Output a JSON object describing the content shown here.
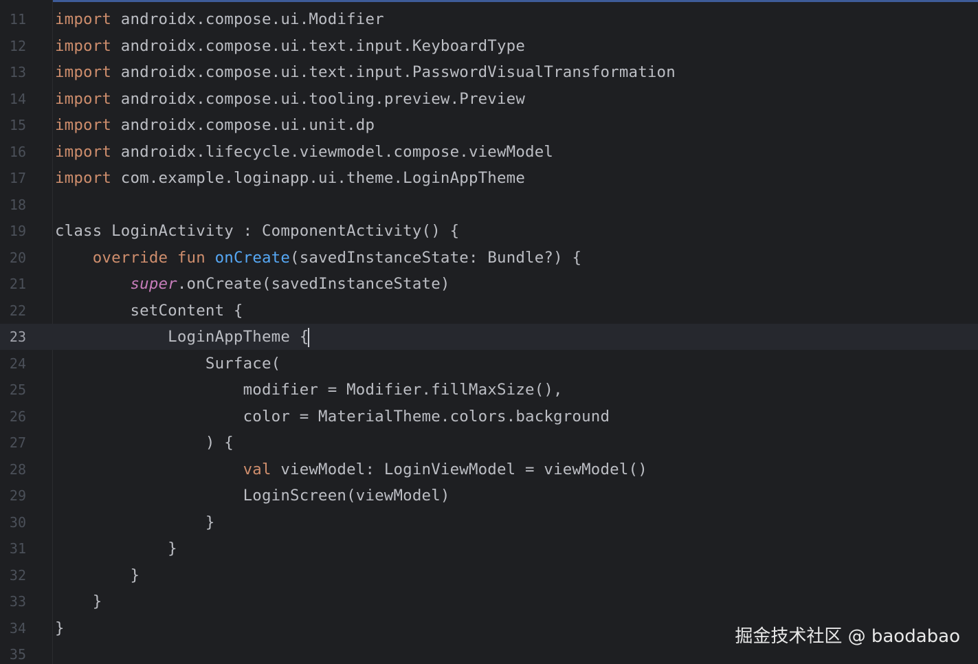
{
  "editor": {
    "lines": [
      {
        "num": "11",
        "tokens": [
          {
            "t": "import",
            "c": "kw"
          },
          {
            "t": " androidx.compose.ui.Modifier",
            "c": "plain"
          }
        ]
      },
      {
        "num": "12",
        "tokens": [
          {
            "t": "import",
            "c": "kw"
          },
          {
            "t": " androidx.compose.ui.text.input.KeyboardType",
            "c": "plain"
          }
        ]
      },
      {
        "num": "13",
        "tokens": [
          {
            "t": "import",
            "c": "kw"
          },
          {
            "t": " androidx.compose.ui.text.input.PasswordVisualTransformation",
            "c": "plain"
          }
        ]
      },
      {
        "num": "14",
        "tokens": [
          {
            "t": "import",
            "c": "kw"
          },
          {
            "t": " androidx.compose.ui.tooling.preview.Preview",
            "c": "plain"
          }
        ]
      },
      {
        "num": "15",
        "tokens": [
          {
            "t": "import",
            "c": "kw"
          },
          {
            "t": " androidx.compose.ui.unit.dp",
            "c": "plain"
          }
        ]
      },
      {
        "num": "16",
        "tokens": [
          {
            "t": "import",
            "c": "kw"
          },
          {
            "t": " androidx.lifecycle.viewmodel.compose.viewModel",
            "c": "plain"
          }
        ]
      },
      {
        "num": "17",
        "tokens": [
          {
            "t": "import",
            "c": "kw"
          },
          {
            "t": " com.example.loginapp.ui.theme.LoginAppTheme",
            "c": "plain"
          }
        ]
      },
      {
        "num": "18",
        "tokens": []
      },
      {
        "num": "19",
        "tokens": [
          {
            "t": "class LoginActivity : ComponentActivity() {",
            "c": "plain"
          }
        ]
      },
      {
        "num": "20",
        "tokens": [
          {
            "t": "    ",
            "c": "plain"
          },
          {
            "t": "override fun",
            "c": "kw"
          },
          {
            "t": " ",
            "c": "plain"
          },
          {
            "t": "onCreate",
            "c": "fn"
          },
          {
            "t": "(savedInstanceState: Bundle?) {",
            "c": "plain"
          }
        ]
      },
      {
        "num": "21",
        "tokens": [
          {
            "t": "        ",
            "c": "plain"
          },
          {
            "t": "super",
            "c": "sup"
          },
          {
            "t": ".onCreate(savedInstanceState)",
            "c": "plain"
          }
        ]
      },
      {
        "num": "22",
        "tokens": [
          {
            "t": "        setContent {",
            "c": "plain"
          }
        ]
      },
      {
        "num": "23",
        "current": true,
        "tokens": [
          {
            "t": "            LoginAppTheme {",
            "c": "plain"
          }
        ]
      },
      {
        "num": "24",
        "tokens": [
          {
            "t": "                Surface(",
            "c": "plain"
          }
        ]
      },
      {
        "num": "25",
        "tokens": [
          {
            "t": "                    modifier = Modifier.fillMaxSize(),",
            "c": "plain"
          }
        ]
      },
      {
        "num": "26",
        "tokens": [
          {
            "t": "                    color = MaterialTheme.colors.background",
            "c": "plain"
          }
        ]
      },
      {
        "num": "27",
        "tokens": [
          {
            "t": "                ) {",
            "c": "plain"
          }
        ]
      },
      {
        "num": "28",
        "tokens": [
          {
            "t": "                    ",
            "c": "plain"
          },
          {
            "t": "val",
            "c": "kw"
          },
          {
            "t": " viewModel: LoginViewModel = viewModel()",
            "c": "plain"
          }
        ]
      },
      {
        "num": "29",
        "tokens": [
          {
            "t": "                    LoginScreen(viewModel)",
            "c": "plain"
          }
        ]
      },
      {
        "num": "30",
        "tokens": [
          {
            "t": "                }",
            "c": "plain"
          }
        ]
      },
      {
        "num": "31",
        "tokens": [
          {
            "t": "            }",
            "c": "plain"
          }
        ]
      },
      {
        "num": "32",
        "tokens": [
          {
            "t": "        }",
            "c": "plain"
          }
        ]
      },
      {
        "num": "33",
        "tokens": [
          {
            "t": "    }",
            "c": "plain"
          }
        ]
      },
      {
        "num": "34",
        "tokens": [
          {
            "t": "}",
            "c": "plain"
          }
        ]
      },
      {
        "num": "35",
        "tokens": []
      }
    ]
  },
  "colors": {
    "background": "#1e1f22",
    "current_line": "#26282e",
    "keyword": "#cf8e6d",
    "function": "#56a8f5",
    "super": "#c77dbb",
    "text": "#bcbec4",
    "line_number": "#4b5059"
  },
  "watermark": "掘金技术社区 @ baodabao"
}
